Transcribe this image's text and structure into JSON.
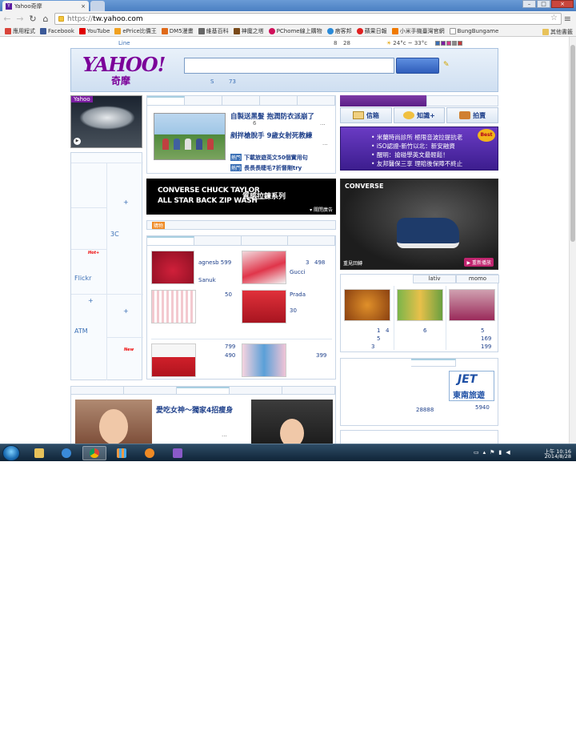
{
  "browser": {
    "tab_title": "Yahoo奇摩",
    "tab_close": "×",
    "url_scheme": "https://",
    "url_host": "tw.yahoo.com",
    "bookmarks": [
      {
        "label": "應用程式",
        "color": "#d9443a"
      },
      {
        "label": "Facebook",
        "color": "#3b5998"
      },
      {
        "label": "YouTube",
        "color": "#e00000"
      },
      {
        "label": "ePrice比價王",
        "color": "#f0a020"
      },
      {
        "label": "DM5漫畫",
        "color": "#e06a1a"
      },
      {
        "label": "維基百科",
        "color": "#666666"
      },
      {
        "label": "神魔之塔",
        "color": "#7a4a1a"
      },
      {
        "label": "PChome線上購物",
        "color": "#d0105a"
      },
      {
        "label": "痞客邦",
        "color": "#2a8ad8"
      },
      {
        "label": "蘋果日報",
        "color": "#e02020"
      },
      {
        "label": "小米手機臺灣官網",
        "color": "#f07a00"
      },
      {
        "label": "BungBungame",
        "color": "#999999"
      }
    ],
    "other_bookmarks": "其他書籤"
  },
  "page": {
    "topstrip": {
      "line": "Line",
      "date_month": "8",
      "date_day": "28",
      "weather": "24°c ~ 33°c",
      "swatches": [
        "#3a6fb5",
        "#7b1ea2",
        "#d43c8c",
        "#8a8a8a",
        "#c23b3b"
      ]
    },
    "logo": {
      "main": "YAHOO!",
      "sub": "奇摩"
    },
    "search_hint_a": "S",
    "search_hint_b": "73",
    "left": {
      "promo_tag": "Yahoo",
      "items": {
        "tech": "3C",
        "flickr": "Flickr",
        "atm": "ATM",
        "plus": "+",
        "hot": "Hot+",
        "new": "New"
      }
    },
    "news": {
      "headline1": "自製送黑髮 抱潤防衣派崩了",
      "headline2": "剷拌槍脫手 9歲女射死教練",
      "n1": "6",
      "n2": "...",
      "n3": "...",
      "link1_tag": "熱門",
      "link1": "下載旅遊英文50個實用句",
      "link2_tag": "熱門",
      "link2": "長長長睫毛7折督剛try"
    },
    "ad_banner": {
      "line1": "CONVERSE CHUCK TAYLOR",
      "line2": "ALL STAR BACK ZIP WASH",
      "line3": "質感拉鍊系列",
      "close": "▾ 關閉廣告"
    },
    "shop_label": "購物",
    "shop": {
      "p1": "agnesb 599",
      "p1b": "Sanuk",
      "p2a": "3",
      "p2b": "498",
      "p2c": "Gucci",
      "p3": "50",
      "p4": "Prada",
      "p4b": "30",
      "p5a": "799",
      "p5b": "490",
      "p6": "399"
    },
    "bottom": {
      "headline": "愛吃女神～獨家4招瘦身",
      "dots": "..."
    },
    "right": {
      "services": [
        {
          "label": "信箱",
          "icon": "mail-icon"
        },
        {
          "label": "知識+",
          "icon": "knowledge-icon"
        },
        {
          "label": "拍賣",
          "icon": "auction-icon"
        }
      ],
      "promo_lines": [
        "米蘭時尚診所 極限音波拉提抗老",
        "iSO認證-新竹以北：新安融資",
        "醒明：搶碰學英文最輕鬆！",
        "友邦醫保三享 理賠後保障不終止"
      ],
      "best": "Best",
      "converse": {
        "brand": "CONVERSE",
        "replay": "重見回轉",
        "refresh": "▶ 重新播放"
      },
      "lativ": {
        "tab1": "lativ",
        "tab2": "momo",
        "c1a": "1",
        "c1b": "4",
        "c1c": "5",
        "c1d": "3",
        "c2": "6",
        "c3a": "5",
        "c3b": "169",
        "c3c": "199"
      },
      "jet": {
        "logo1": "JET",
        "logo2": "東南旅遊",
        "n1": "28888",
        "n2": "5940"
      }
    }
  },
  "taskbar": {
    "time": "上午 10:16",
    "date": "2014/8/28"
  }
}
